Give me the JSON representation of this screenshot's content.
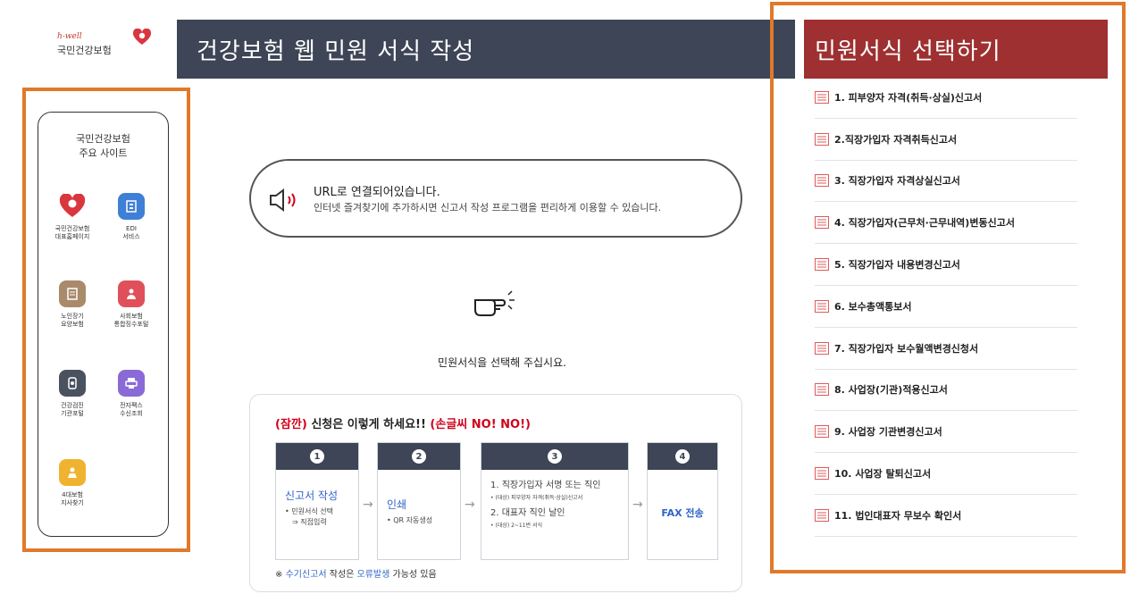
{
  "logo": {
    "sub": "h-well",
    "name": "국민건강보험"
  },
  "header": {
    "title": "건강보험 웹 민원 서식 작성"
  },
  "sidebar": {
    "title_line1": "국민건강보험",
    "title_line2": "주요 사이트",
    "items": [
      {
        "label": "국민건강보험\n대표홈페이지",
        "icon": "heart-icon",
        "color": "#d9363e"
      },
      {
        "label": "EDI\n서비스",
        "icon": "building-icon",
        "color": "#3f7fd6"
      },
      {
        "label": "노인장기\n요양보험",
        "icon": "document-icon",
        "color": "#a98a6a"
      },
      {
        "label": "사회보험\n통합징수포털",
        "icon": "people-icon",
        "color": "#e0505a"
      },
      {
        "label": "건강검진\n기관포털",
        "icon": "device-icon",
        "color": "#4a5260"
      },
      {
        "label": "전자팩스\n수신조회",
        "icon": "printer-icon",
        "color": "#8a6ad6"
      },
      {
        "label": "4대보험\n지사찾기",
        "icon": "branch-icon",
        "color": "#f0b330"
      }
    ]
  },
  "notice": {
    "line1": "URL로 연결되어있습니다.",
    "line2": "인터넷 즐겨찾기에 추가하시면 신고서 작성 프로그램을 편리하게 이용할 수 있습니다."
  },
  "select_message": "민원서식을 선택해 주십시요.",
  "steps": {
    "title_red1": "(잠깐)",
    "title_mid": " 신청은 이렇게 하세요!! ",
    "title_red2": "(손글씨 NO! NO!)",
    "items": [
      {
        "num": "1",
        "main": "신고서 작성",
        "sub1": "• 민원서식 선택",
        "sub2": "⇒ 직접입력"
      },
      {
        "num": "2",
        "main": "인쇄",
        "sub1": "• QR 자동생성"
      },
      {
        "num": "3",
        "main": "1. 직장가입자 서명 또는 직인",
        "sub1": "• (대상) 피부양자 자격(취득·상실)신고서",
        "main2": "2. 대표자 직인 날인",
        "sub2": "• (대상) 2~11번 서식"
      },
      {
        "num": "4",
        "main": "FAX 전송"
      }
    ],
    "arrow": "→",
    "note_prefix": "※ ",
    "note_blue": "수기신고서",
    "note_mid": " 작성은 ",
    "note_blue2": "오류발생",
    "note_end": " 가능성 있음"
  },
  "form_list": {
    "title": "민원서식 선택하기",
    "items": [
      "1. 피부양자 자격(취득·상실)신고서",
      "2.직장가입자 자격취득신고서",
      "3. 직장가입자 자격상실신고서",
      "4. 직장가입자(근무처·근무내역)변동신고서",
      "5. 직장가입자 내용변경신고서",
      "6. 보수총액통보서",
      "7. 직장가입자 보수월액변경신청서",
      "8. 사업장(기관)적용신고서",
      "9. 사업장 기관변경신고서",
      "10. 사업장 탈퇴신고서",
      "11. 법인대표자 무보수 확인서"
    ]
  },
  "colors": {
    "header_bg": "#3d4556",
    "list_header_bg": "#9e3031",
    "frame": "#e1792a",
    "accent_red": "#d0021b",
    "accent_blue": "#2f64c8"
  }
}
